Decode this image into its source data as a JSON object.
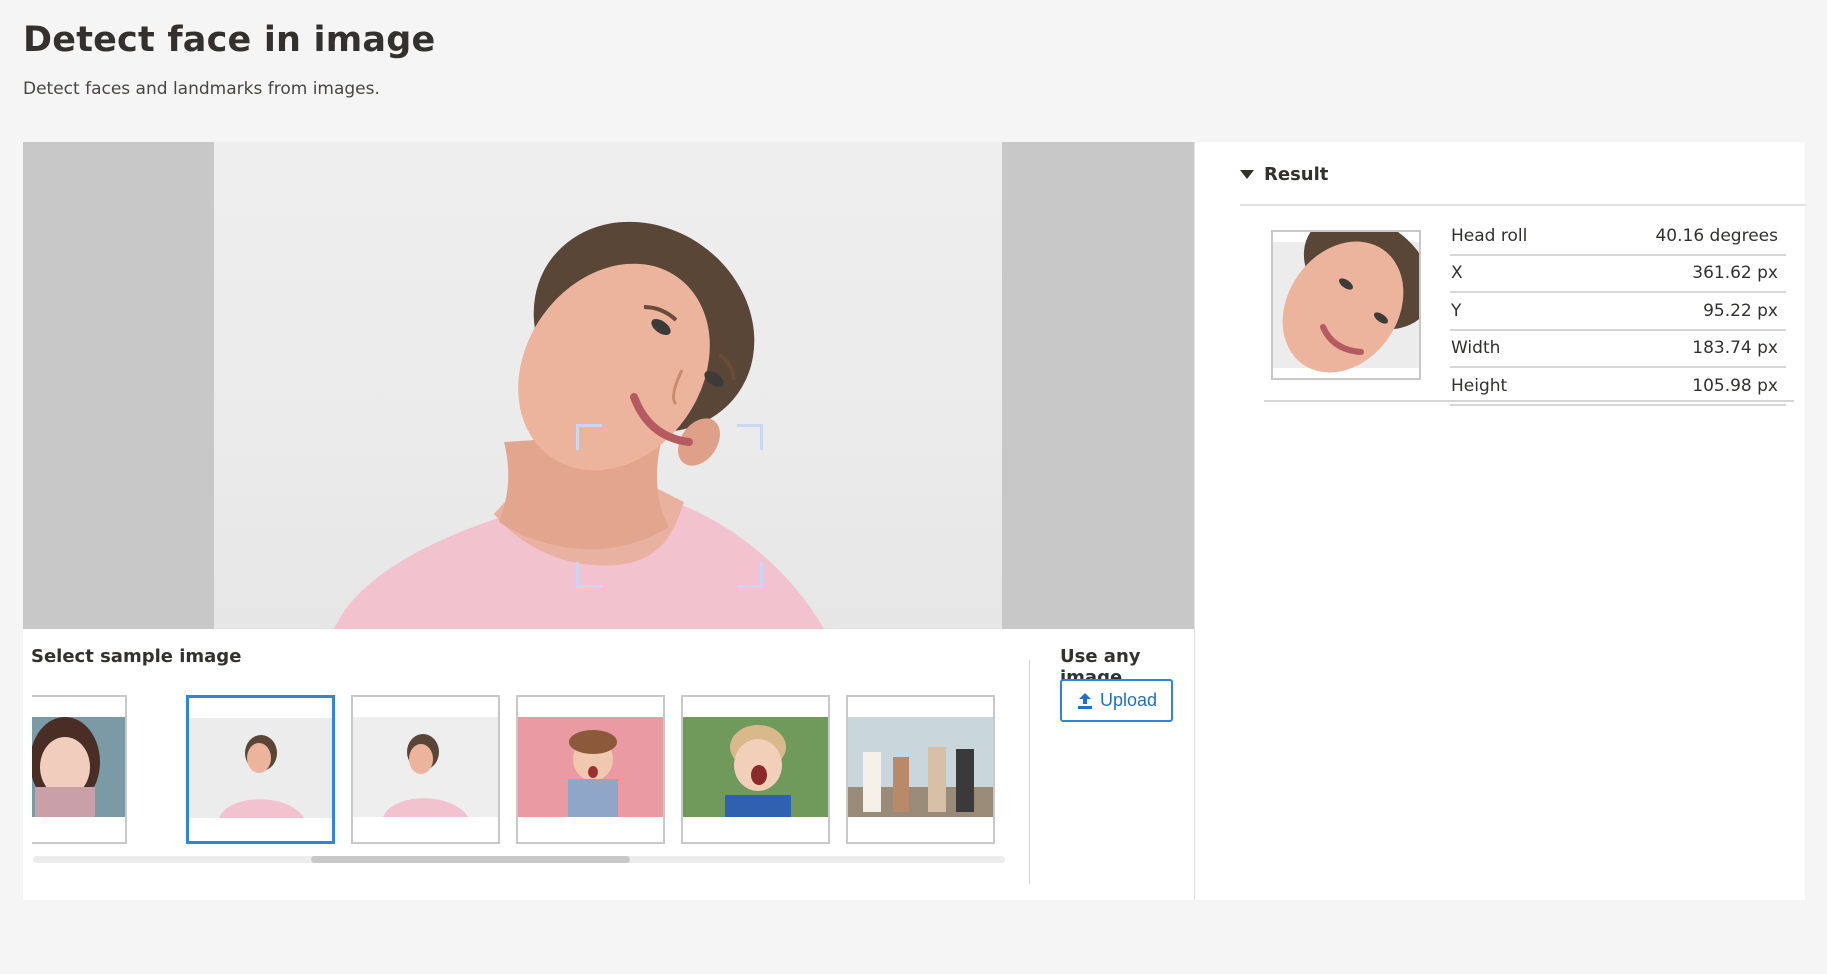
{
  "page": {
    "title": "Detect face in image",
    "subtitle": "Detect faces and landmarks from images."
  },
  "samples": {
    "label": "Select sample image",
    "items": [
      {
        "name": "sample-woman-hands-face",
        "selected": false
      },
      {
        "name": "sample-woman-tilted-head",
        "selected": true
      },
      {
        "name": "sample-woman-tilted-head-2",
        "selected": false
      },
      {
        "name": "sample-girl-pink-background",
        "selected": false
      },
      {
        "name": "sample-boy-yawning",
        "selected": false
      },
      {
        "name": "sample-group-outdoor",
        "selected": false
      }
    ]
  },
  "upload": {
    "label": "Use any image",
    "button_label": "Upload",
    "icon": "upload-icon"
  },
  "result": {
    "header": "Result",
    "rows": [
      {
        "label": "Head roll",
        "value": "40.16 degrees"
      },
      {
        "label": "X",
        "value": "361.62 px"
      },
      {
        "label": "Y",
        "value": "95.22 px"
      },
      {
        "label": "Width",
        "value": "183.74 px"
      },
      {
        "label": "Height",
        "value": "105.98 px"
      }
    ]
  },
  "colors": {
    "accent": "#2f86d8",
    "face_box": "#c9d7f5",
    "page_background": "#f5f5f5"
  }
}
